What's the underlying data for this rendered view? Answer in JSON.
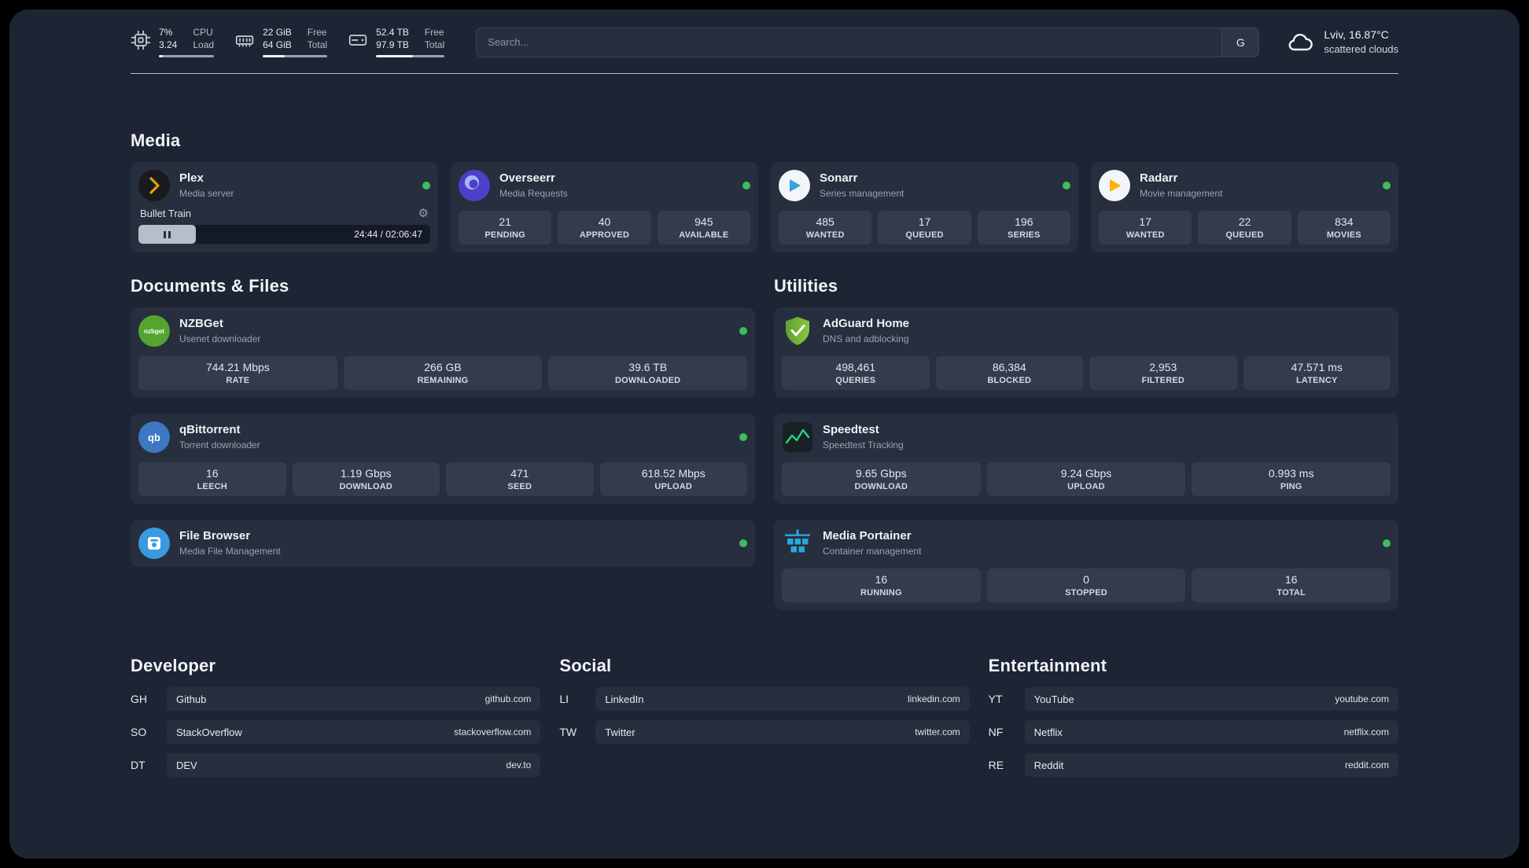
{
  "topbar": {
    "cpu": {
      "value_top": "7%",
      "value_bottom": "3.24",
      "label_top": "CPU",
      "label_bottom": "Load"
    },
    "ram": {
      "value_top": "22 GiB",
      "value_bottom": "64 GiB",
      "label_top": "Free",
      "label_bottom": "Total"
    },
    "disk": {
      "value_top": "52.4 TB",
      "value_bottom": "97.9 TB",
      "label_top": "Free",
      "label_bottom": "Total"
    },
    "search": {
      "placeholder": "Search...",
      "engine": "G"
    },
    "weather": {
      "location": "Lviv, 16.87°C",
      "condition": "scattered clouds"
    }
  },
  "icons": {
    "nzbget_text": "nzbget",
    "qbittorrent_text": "qb"
  },
  "media": {
    "title": "Media",
    "plex": {
      "name": "Plex",
      "subtitle": "Media server",
      "player": {
        "track": "Bullet Train",
        "time": "24:44 / 02:06:47"
      }
    },
    "overseerr": {
      "name": "Overseerr",
      "subtitle": "Media Requests",
      "stats": [
        {
          "value": "21",
          "label": "PENDING"
        },
        {
          "value": "40",
          "label": "APPROVED"
        },
        {
          "value": "945",
          "label": "AVAILABLE"
        }
      ]
    },
    "sonarr": {
      "name": "Sonarr",
      "subtitle": "Series management",
      "stats": [
        {
          "value": "485",
          "label": "WANTED"
        },
        {
          "value": "17",
          "label": "QUEUED"
        },
        {
          "value": "196",
          "label": "SERIES"
        }
      ]
    },
    "radarr": {
      "name": "Radarr",
      "subtitle": "Movie management",
      "stats": [
        {
          "value": "17",
          "label": "WANTED"
        },
        {
          "value": "22",
          "label": "QUEUED"
        },
        {
          "value": "834",
          "label": "MOVIES"
        }
      ]
    }
  },
  "documents": {
    "title": "Documents & Files",
    "nzbget": {
      "name": "NZBGet",
      "subtitle": "Usenet downloader",
      "stats": [
        {
          "value": "744.21 Mbps",
          "label": "RATE"
        },
        {
          "value": "266 GB",
          "label": "REMAINING"
        },
        {
          "value": "39.6 TB",
          "label": "DOWNLOADED"
        }
      ]
    },
    "qbittorrent": {
      "name": "qBittorrent",
      "subtitle": "Torrent downloader",
      "stats": [
        {
          "value": "16",
          "label": "LEECH"
        },
        {
          "value": "1.19 Gbps",
          "label": "DOWNLOAD"
        },
        {
          "value": "471",
          "label": "SEED"
        },
        {
          "value": "618.52 Mbps",
          "label": "UPLOAD"
        }
      ]
    },
    "filebrowser": {
      "name": "File Browser",
      "subtitle": "Media File Management"
    }
  },
  "utilities": {
    "title": "Utilities",
    "adguard": {
      "name": "AdGuard Home",
      "subtitle": "DNS and adblocking",
      "stats": [
        {
          "value": "498,461",
          "label": "QUERIES"
        },
        {
          "value": "86,384",
          "label": "BLOCKED"
        },
        {
          "value": "2,953",
          "label": "FILTERED"
        },
        {
          "value": "47.571 ms",
          "label": "LATENCY"
        }
      ]
    },
    "speedtest": {
      "name": "Speedtest",
      "subtitle": "Speedtest Tracking",
      "stats": [
        {
          "value": "9.65 Gbps",
          "label": "DOWNLOAD"
        },
        {
          "value": "9.24 Gbps",
          "label": "UPLOAD"
        },
        {
          "value": "0.993 ms",
          "label": "PING"
        }
      ]
    },
    "portainer": {
      "name": "Media Portainer",
      "subtitle": "Container management",
      "stats": [
        {
          "value": "16",
          "label": "RUNNING"
        },
        {
          "value": "0",
          "label": "STOPPED"
        },
        {
          "value": "16",
          "label": "TOTAL"
        }
      ]
    }
  },
  "bookmarks": {
    "developer": {
      "title": "Developer",
      "items": [
        {
          "abbr": "GH",
          "name": "Github",
          "url": "github.com"
        },
        {
          "abbr": "SO",
          "name": "StackOverflow",
          "url": "stackoverflow.com"
        },
        {
          "abbr": "DT",
          "name": "DEV",
          "url": "dev.to"
        }
      ]
    },
    "social": {
      "title": "Social",
      "items": [
        {
          "abbr": "LI",
          "name": "LinkedIn",
          "url": "linkedin.com"
        },
        {
          "abbr": "TW",
          "name": "Twitter",
          "url": "twitter.com"
        }
      ]
    },
    "entertainment": {
      "title": "Entertainment",
      "items": [
        {
          "abbr": "YT",
          "name": "YouTube",
          "url": "youtube.com"
        },
        {
          "abbr": "NF",
          "name": "Netflix",
          "url": "netflix.com"
        },
        {
          "abbr": "RE",
          "name": "Reddit",
          "url": "reddit.com"
        }
      ]
    }
  }
}
